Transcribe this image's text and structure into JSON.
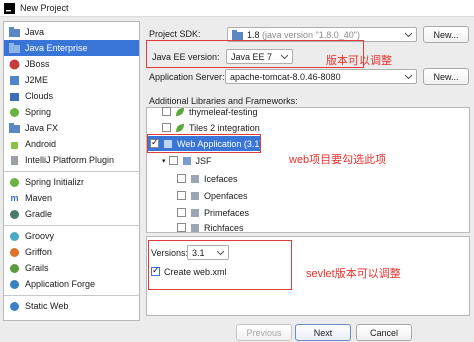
{
  "window": {
    "title": "New Project"
  },
  "sidebar": {
    "items": [
      {
        "label": "Java",
        "icon": "folder-icon"
      },
      {
        "label": "Java Enterprise",
        "icon": "folder-icon",
        "selected": true
      },
      {
        "label": "JBoss",
        "icon": "jboss-icon"
      },
      {
        "label": "J2ME",
        "icon": "j2me-icon"
      },
      {
        "label": "Clouds",
        "icon": "cloud-icon"
      },
      {
        "label": "Spring",
        "icon": "spring-icon"
      },
      {
        "label": "Java FX",
        "icon": "folder-icon"
      },
      {
        "label": "Android",
        "icon": "android-icon"
      },
      {
        "label": "IntelliJ Platform Plugin",
        "icon": "plugin-icon"
      },
      {
        "label": "Spring Initializr",
        "icon": "spring-icon"
      },
      {
        "label": "Maven",
        "icon": "maven-icon"
      },
      {
        "label": "Gradle",
        "icon": "gradle-icon"
      },
      {
        "label": "Groovy",
        "icon": "groovy-icon"
      },
      {
        "label": "Griffon",
        "icon": "griffon-icon"
      },
      {
        "label": "Grails",
        "icon": "grails-icon"
      },
      {
        "label": "Application Forge",
        "icon": "forge-icon"
      },
      {
        "label": "Static Web",
        "icon": "web-icon"
      }
    ]
  },
  "form": {
    "sdk_label": "Project SDK:",
    "sdk_value": "1.8",
    "sdk_detail": "(java version \"1.8.0_40\")",
    "new_label": "New...",
    "javaee_label": "Java EE version:",
    "javaee_value": "Java EE 7",
    "server_label": "Application Server:",
    "server_value": "apache-tomcat-8.0.46-8080",
    "libs_label": "Additional Libraries and Frameworks:"
  },
  "libraries": {
    "thymeleaf": "thymeleaf-testing",
    "tiles": "Tiles 2 integration",
    "webapp": "Web Application (3.1)",
    "jsf": "JSF",
    "icefaces": "Icefaces",
    "openfaces": "Openfaces",
    "primefaces": "Primefaces",
    "richfaces": "Richfaces"
  },
  "version_panel": {
    "versions_label": "Versions:",
    "versions_value": "3.1",
    "create_label": "Create web.xml"
  },
  "buttons": {
    "previous": "Previous",
    "next": "Next",
    "cancel": "Cancel"
  },
  "annotations": {
    "javaee_note": "版本可以调整",
    "webapp_note": "web项目要勾选此项",
    "servlet_note": "sevlet版本可以调整"
  },
  "colors": {
    "selection": "#3875d7",
    "annotation": "#e8322f"
  }
}
